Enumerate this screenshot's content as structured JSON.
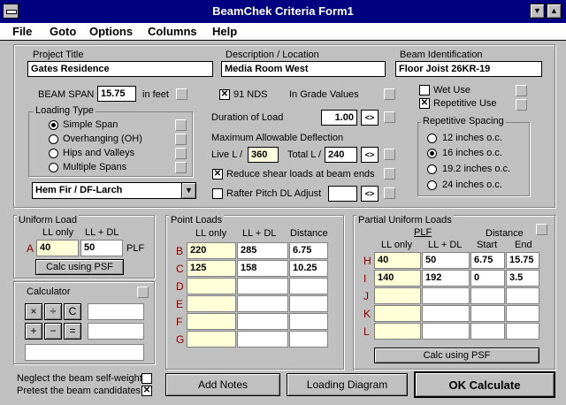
{
  "window": {
    "title": "BeamChek  Criteria Form1"
  },
  "menu": [
    "File",
    "Goto",
    "Options",
    "Columns",
    "Help"
  ],
  "project": {
    "title_label": "Project Title",
    "title_value": "Gates Residence",
    "desc_label": "Description / Location",
    "desc_value": "Media Room West",
    "beam_label": "Beam Identification",
    "beam_value": "Floor Joist 26KR-19"
  },
  "beam_span": {
    "label": "BEAM SPAN",
    "value": "15.75",
    "unit": "in feet"
  },
  "loading_type": {
    "label": "Loading Type",
    "options": [
      "Simple Span",
      "Overhanging (OH)",
      "Hips and Valleys",
      "Multiple Spans"
    ],
    "selected": 0
  },
  "species": {
    "value": "Hem Fir / DF-Larch"
  },
  "nds": {
    "label": "91 NDS",
    "checked": true,
    "grade_label": "In Grade Values"
  },
  "duration": {
    "label": "Duration of Load",
    "value": "1.00",
    "btn": "<>"
  },
  "deflection": {
    "label": "Maximum Allowable Deflection",
    "live_label": "Live L /",
    "live_value": "360",
    "total_label": "Total L /",
    "total_value": "240",
    "btn": "<>"
  },
  "shear": {
    "label": "Reduce shear loads at beam ends",
    "checked": true
  },
  "rafter": {
    "label": "Rafter Pitch DL Adjust",
    "value": "",
    "btn": "<>"
  },
  "use": {
    "wet_label": "Wet Use",
    "wet_checked": false,
    "rep_label": "Repetitive Use",
    "rep_checked": true
  },
  "rep_spacing": {
    "label": "Repetitive Spacing",
    "options": [
      "12 inches o.c.",
      "16 inches o.c.",
      "19.2 inches o.c.",
      "24 inches o.c."
    ],
    "selected": 1
  },
  "uniform": {
    "label": "Uniform Load",
    "col_ll": "LL only",
    "col_lldl": "LL + DL",
    "row": "A",
    "ll": "40",
    "lldl": "50",
    "unit": "PLF",
    "btn": "Calc using PSF"
  },
  "calculator": {
    "label": "Calculator",
    "keys": [
      "×",
      "÷",
      "C",
      "+",
      "−",
      "="
    ]
  },
  "point_loads": {
    "label": "Point Loads",
    "cols": [
      "LL only",
      "LL + DL",
      "Distance"
    ],
    "rows": [
      {
        "id": "B",
        "ll": "220",
        "lldl": "285",
        "dist": "6.75"
      },
      {
        "id": "C",
        "ll": "125",
        "lldl": "158",
        "dist": "10.25"
      },
      {
        "id": "D",
        "ll": "",
        "lldl": "",
        "dist": ""
      },
      {
        "id": "E",
        "ll": "",
        "lldl": "",
        "dist": ""
      },
      {
        "id": "F",
        "ll": "",
        "lldl": "",
        "dist": ""
      },
      {
        "id": "G",
        "ll": "",
        "lldl": "",
        "dist": ""
      }
    ]
  },
  "partial": {
    "label": "Partial Uniform Loads",
    "plf": "PLF",
    "distance": "Distance",
    "cols": [
      "LL only",
      "LL + DL",
      "Start",
      "End"
    ],
    "rows": [
      {
        "id": "H",
        "ll": "40",
        "lldl": "50",
        "start": "6.75",
        "end": "15.75"
      },
      {
        "id": "I",
        "ll": "140",
        "lldl": "192",
        "start": "0",
        "end": "3.5"
      },
      {
        "id": "J",
        "ll": "",
        "lldl": "",
        "start": "",
        "end": ""
      },
      {
        "id": "K",
        "ll": "",
        "lldl": "",
        "start": "",
        "end": ""
      },
      {
        "id": "L",
        "ll": "",
        "lldl": "",
        "start": "",
        "end": ""
      }
    ],
    "btn": "Calc using PSF"
  },
  "options": {
    "neglect_label": "Neglect the beam self-weight",
    "neglect_checked": false,
    "pretest_label": "Pretest the beam candidates",
    "pretest_checked": true
  },
  "buttons": {
    "add_notes": "Add Notes",
    "loading_diagram": "Loading Diagram",
    "ok": "OK Calculate"
  }
}
